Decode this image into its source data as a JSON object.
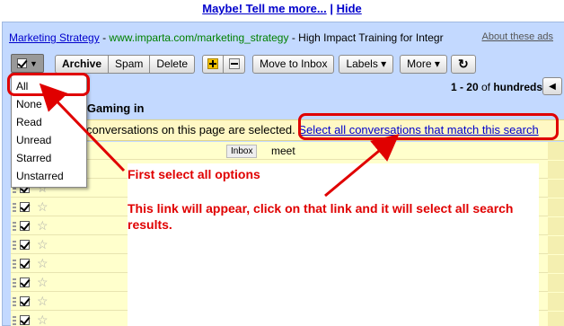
{
  "promo": {
    "link": "Maybe! Tell me more...",
    "separator": "|",
    "hide": "Hide"
  },
  "ad": {
    "title": "Marketing Strategy",
    "dash": "-",
    "url": "www.imparta.com/marketing_strategy",
    "text": "- High Impact Training for Integr",
    "about": "About these ads"
  },
  "toolbar": {
    "archive": "Archive",
    "spam": "Spam",
    "delete": "Delete",
    "move_to_inbox": "Move to Inbox",
    "labels": "Labels ▾",
    "more": "More ▾",
    "refresh_icon": "↻"
  },
  "pager": {
    "range": "1 - 20",
    "of": "of",
    "total": "hundreds",
    "prev_icon": "◀"
  },
  "results": {
    "label": "ts for:Gaming in"
  },
  "notice": {
    "text": "conversations on this page are selected.",
    "link": "Select all conversations that match this search"
  },
  "row0": {
    "label": "Inbox",
    "subject": "meet"
  },
  "dropdown": {
    "items": [
      "All",
      "None",
      "Read",
      "Unread",
      "Starred",
      "Unstarred"
    ]
  },
  "annotations": {
    "first": "First select all options",
    "second": "This link will appear, click on that link and it will select all search results."
  },
  "colors": {
    "annotation": "#e00000",
    "panel": "#c3d9ff",
    "list": "#ffffcc",
    "link": "#0000cc"
  }
}
